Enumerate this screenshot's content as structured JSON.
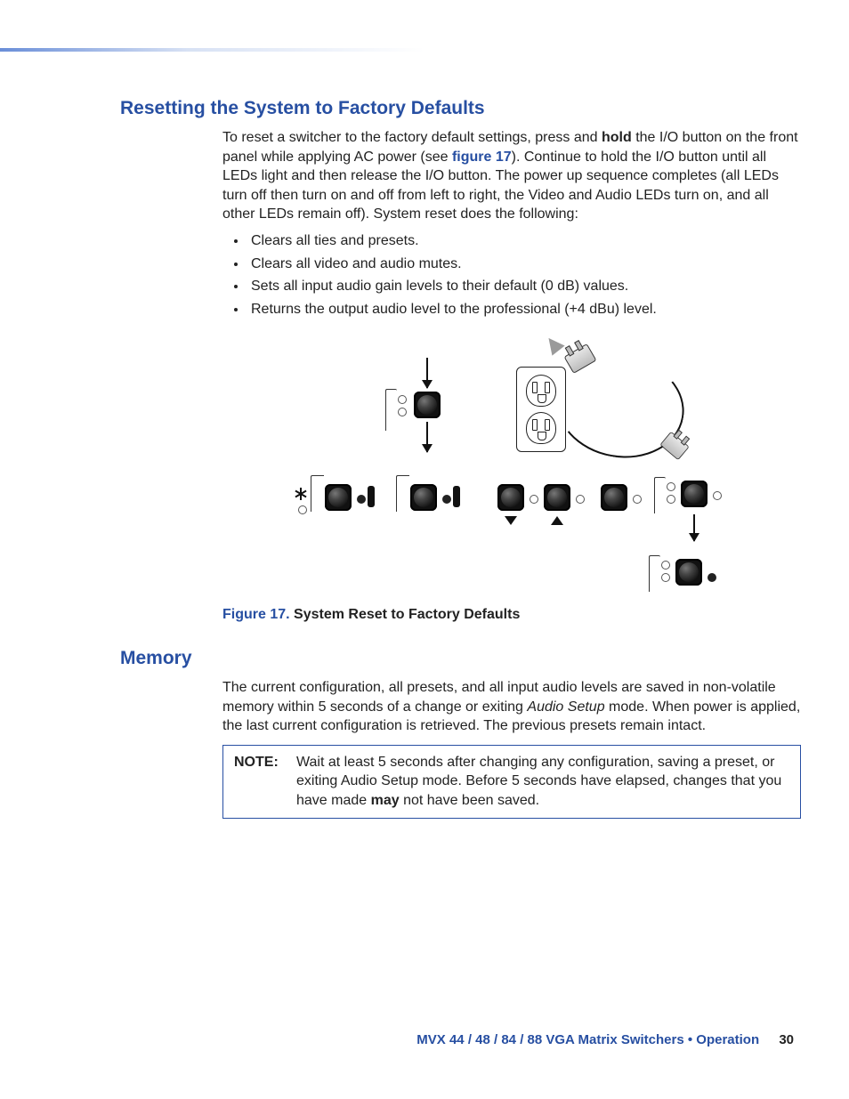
{
  "sections": {
    "reset": {
      "heading": "Resetting the System to Factory Defaults",
      "para_pre": "To reset a switcher to the factory default settings, press and ",
      "para_hold": "hold",
      "para_mid": " the I/O button on the front panel while applying AC power (see ",
      "para_figref": "figure 17",
      "para_post": "). Continue to hold the I/O button until all LEDs light and then release the I/O button. The power up sequence completes (all LEDs turn off then turn on and off from left to right, the Video and Audio LEDs turn on, and all other LEDs remain off). System reset does the following:",
      "bullets": [
        "Clears all ties and presets.",
        "Clears all video and audio mutes.",
        "Sets all input audio gain levels to their default (0 dB) values.",
        "Returns the output audio level to the professional (+4 dBu) level."
      ],
      "fig_lead": "Figure 17. ",
      "fig_title": "System Reset to Factory Defaults"
    },
    "memory": {
      "heading": "Memory",
      "para_pre": "The current configuration, all presets, and all input audio levels are saved in non-volatile memory within 5 seconds of a change or exiting ",
      "para_italic": "Audio Setup",
      "para_post": " mode. When power is applied, the last current configuration is retrieved. The previous presets remain intact.",
      "note_label": "NOTE:",
      "note_pre": "Wait at least 5 seconds after changing any configuration, saving a preset, or exiting Audio Setup mode. Before 5 seconds have elapsed, changes that you have made ",
      "note_bold": "may",
      "note_post": " not have been saved."
    }
  },
  "footer": {
    "text": "MVX 44 / 48 / 84 / 88 VGA Matrix Switchers • Operation",
    "page": "30"
  }
}
